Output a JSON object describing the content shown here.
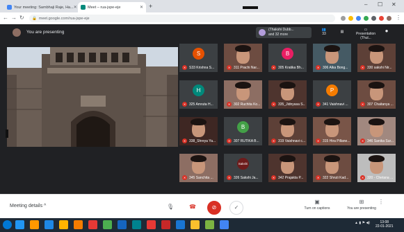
{
  "browser": {
    "tabs": [
      {
        "label": "Your meeting: Sambhaji Raje, Ha...",
        "active": false,
        "favicon_color": "#4285f4"
      },
      {
        "label": "Meet – rua-jspe-eje",
        "active": true,
        "favicon_color": "#00897b"
      }
    ],
    "new_tab": "+",
    "url": "meet.google.com/rua-jspe-eje",
    "window_controls": [
      "–",
      "☐",
      "✕"
    ]
  },
  "meet": {
    "presenting_label": "You are presenting",
    "participants_chip": {
      "line1": "(Thakshi Dubb...",
      "line2": "and 32 more"
    },
    "top_icons": [
      {
        "icon": "participants-icon",
        "label": "",
        "badge": "33"
      },
      {
        "icon": "chat-icon",
        "label": ""
      },
      {
        "icon": "presentation-icon",
        "label": "Presentation (Thul..."
      }
    ],
    "tiles": [
      {
        "name": "S33 Krishna S...",
        "initial": "S",
        "color": "#e65100",
        "type": "initial"
      },
      {
        "name": "311 Prachi Nar...",
        "type": "photo",
        "bg": "#6d4c41"
      },
      {
        "name": "305 Kratika Bh...",
        "initial": "B",
        "color": "#e91e63",
        "type": "initial"
      },
      {
        "name": "306 Alka Bong...",
        "type": "photo",
        "bg": "#455a64"
      },
      {
        "name": "330 sakshi Nir...",
        "type": "photo",
        "bg": "#5d4037"
      },
      {
        "name": "325 Amruta H...",
        "initial": "H",
        "color": "#00897b",
        "type": "initial"
      },
      {
        "name": "302 Ruchita Ko...",
        "type": "photo",
        "bg": "#8d6e63"
      },
      {
        "name": "335_Jidnyasa S...",
        "type": "photo",
        "bg": "#4e342e"
      },
      {
        "name": "341 Vaishnavi ...",
        "initial": "P",
        "color": "#f57c00",
        "type": "initial"
      },
      {
        "name": "307 Chaitanya ...",
        "type": "photo",
        "bg": "#6d4c41"
      },
      {
        "name": "338_Shreya Ya...",
        "type": "photo",
        "bg": "#3e2723"
      },
      {
        "name": "307 RUTIKA B...",
        "initial": "B",
        "color": "#43a047",
        "type": "initial"
      },
      {
        "name": "319 Vaishnavi c...",
        "type": "photo",
        "bg": "#5d4037"
      },
      {
        "name": "315 Hira Pillane...",
        "type": "photo",
        "bg": "#795548"
      },
      {
        "name": "346 Sanika Sur...",
        "type": "photo",
        "bg": "#a1887f"
      },
      {
        "name": "345 Sanchita ...",
        "type": "photo",
        "bg": "#8d6e63"
      },
      {
        "name": "326 Sakshi Ja...",
        "initial": "Sakshi",
        "color": "#6d1b1b",
        "type": "initial"
      },
      {
        "name": "342 Prajakta P...",
        "type": "photo",
        "bg": "#4e342e"
      },
      {
        "name": "322 Shruti Kad...",
        "type": "photo",
        "bg": "#6d4c41"
      },
      {
        "name": "320 - Chetana ...",
        "type": "photo",
        "bg": "#bdbdbd"
      }
    ],
    "bottom": {
      "meeting_details": "Meeting details",
      "captions_label": "Turn on captions",
      "presenting_label": "You are presenting"
    }
  },
  "taskbar": {
    "time": "13:08",
    "date": "22-01-2021",
    "apps": [
      "#2196f3",
      "#ff9800",
      "#1e88e5",
      "#ffb300",
      "#f57c00",
      "#e53935",
      "#4caf50",
      "#1565c0",
      "#00838f",
      "#e53935",
      "#c62828",
      "#1976d2",
      "#fbc02d",
      "#7cb342",
      "#4285f4"
    ]
  }
}
